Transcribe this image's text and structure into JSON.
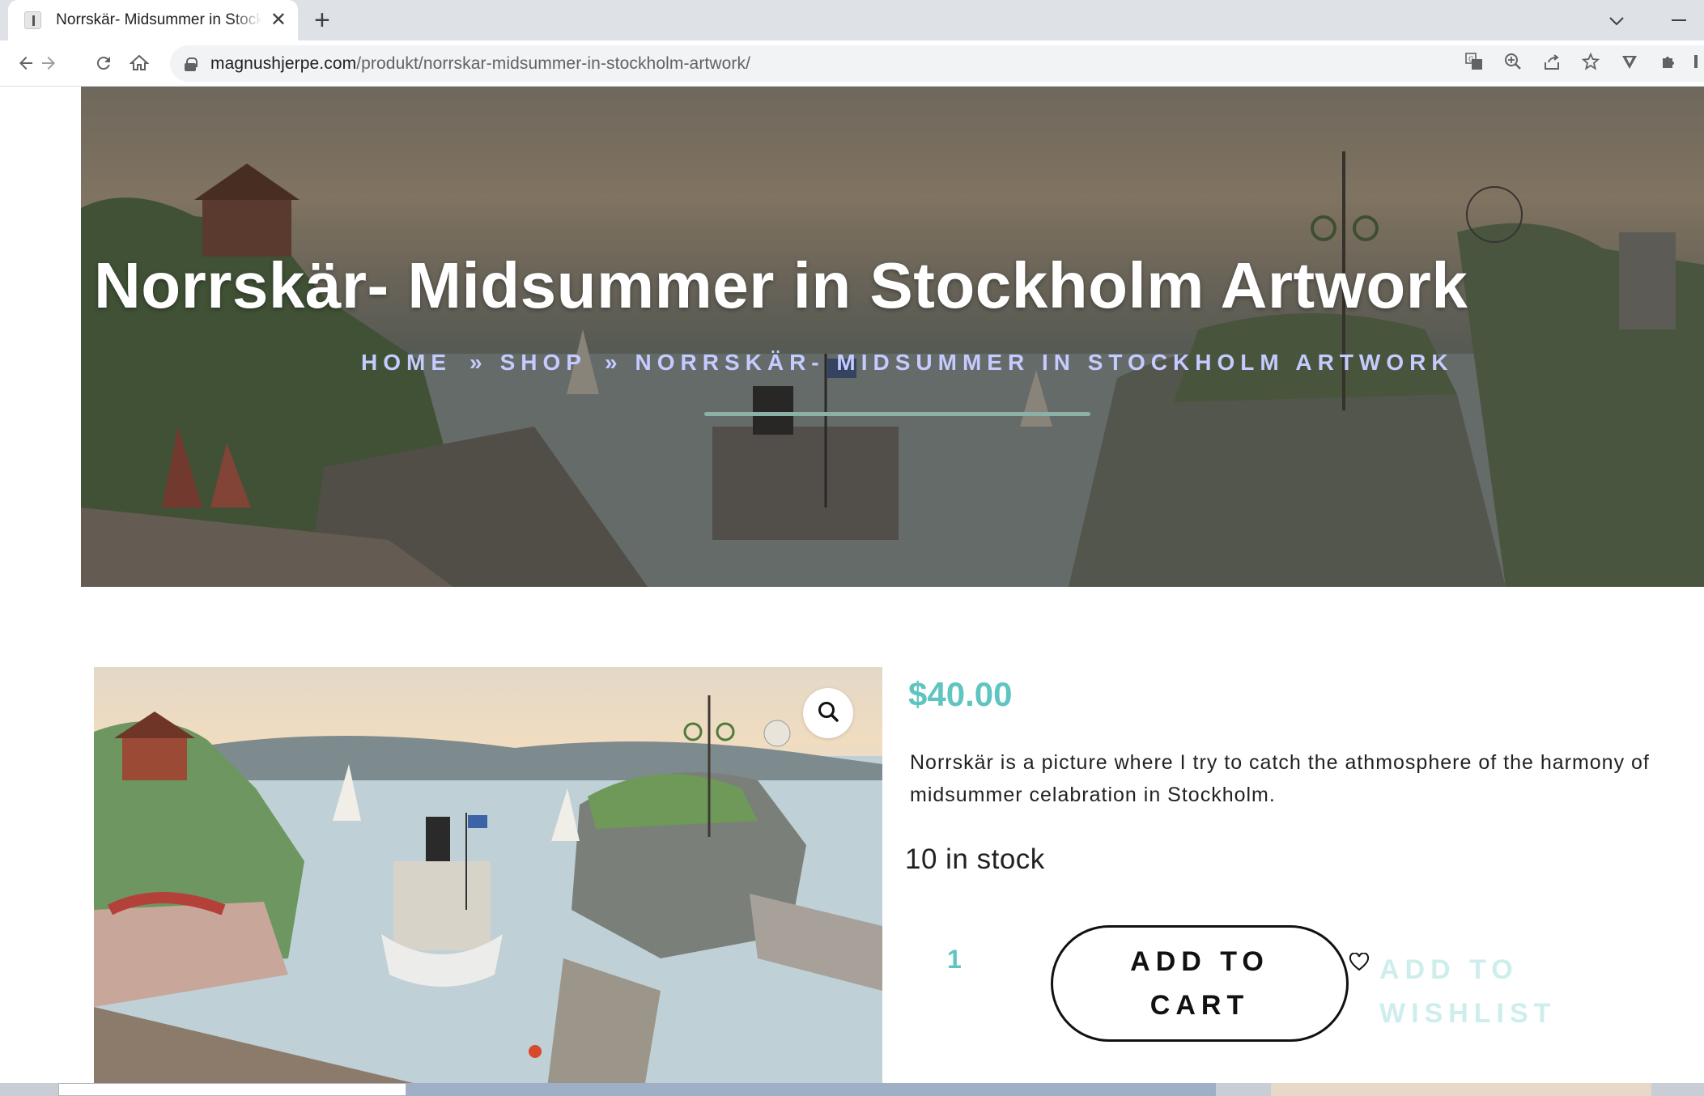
{
  "browser": {
    "tab_title": "Norrskär- Midsummer in Stockholm Artwork",
    "url_domain": "magnushjerpe.com",
    "url_path": "/produkt/norrskar-midsummer-in-stockholm-artwork/",
    "icons": {
      "back": "arrow-left-icon",
      "forward": "arrow-right-icon",
      "reload": "reload-icon",
      "home": "home-icon",
      "translate": "translate-icon",
      "zoom": "zoom-icon",
      "share": "share-icon",
      "bookmark": "star-icon",
      "extension_v": "vivaldi-extension-icon",
      "extensions": "puzzle-icon"
    }
  },
  "hero": {
    "title": "Norrskär- Midsummer in Stockholm Artwork",
    "breadcrumb": {
      "home": "HOME",
      "separator": "»",
      "shop": "SHOP",
      "current": "NORRSKÄR- MIDSUMMER IN STOCKHOLM ARTWORK"
    }
  },
  "product": {
    "price": "$40.00",
    "description": "Norrskär is a picture where I try to catch the athmosphere of the harmony of midsummer celabration in Stockholm.",
    "stock": "10 in stock",
    "quantity": "1",
    "add_to_cart": "ADD TO CART",
    "add_to_wishlist": "ADD TO WISHLIST",
    "image_icon": "magnifier-icon"
  },
  "colors": {
    "accent": "#5fc5c0",
    "breadcrumb": "#c5cbff",
    "wishlist_text": "#cdeeed",
    "hero_rule": "#8bb0a6"
  }
}
